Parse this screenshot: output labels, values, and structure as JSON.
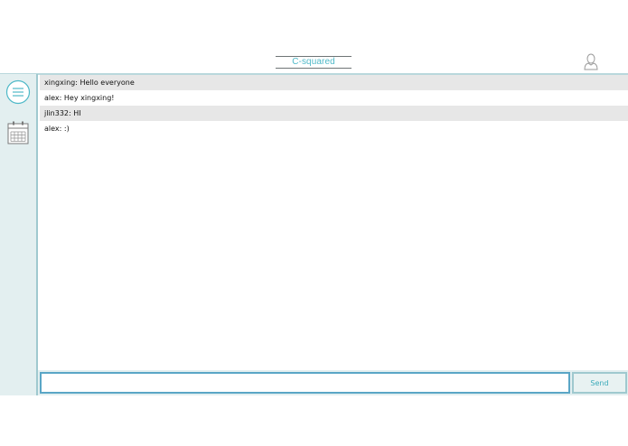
{
  "header": {
    "title": "C-squared",
    "user_icon": "user-icon"
  },
  "sidebar": {
    "items": [
      {
        "icon": "menu-icon"
      },
      {
        "icon": "calendar-icon"
      }
    ]
  },
  "messages": [
    {
      "text": "xingxing: Hello everyone"
    },
    {
      "text": "alex: Hey xingxing!"
    },
    {
      "text": "jlin332: HI"
    },
    {
      "text": "alex: :)"
    }
  ],
  "composer": {
    "input_value": "",
    "placeholder": "",
    "send_label": "Send"
  },
  "colors": {
    "accent": "#4fb9c8",
    "sidebar_bg": "#e3eff0",
    "input_border": "#5aa6c6"
  }
}
